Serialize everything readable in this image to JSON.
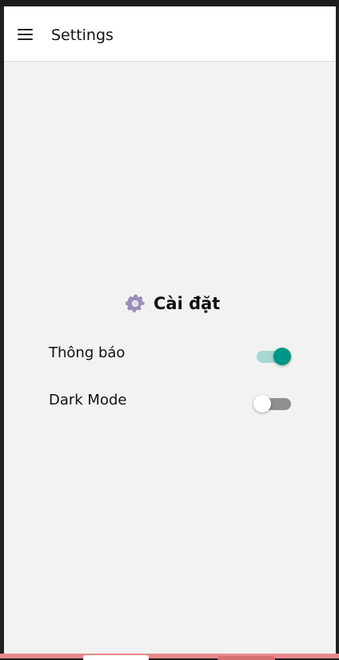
{
  "appbar": {
    "title": "Settings",
    "menu_icon": "hamburger-menu-icon"
  },
  "main": {
    "heading": "Cài đặt",
    "heading_icon": "gear-icon",
    "settings": [
      {
        "label": "Thông báo",
        "enabled": true
      },
      {
        "label": "Dark Mode",
        "enabled": false
      }
    ]
  },
  "colors": {
    "accent": "#009688",
    "accent_track": "#a6d7d2",
    "off_track": "#8f8f8f",
    "background": "#f2f2f2",
    "appbar_background": "#ffffff"
  }
}
